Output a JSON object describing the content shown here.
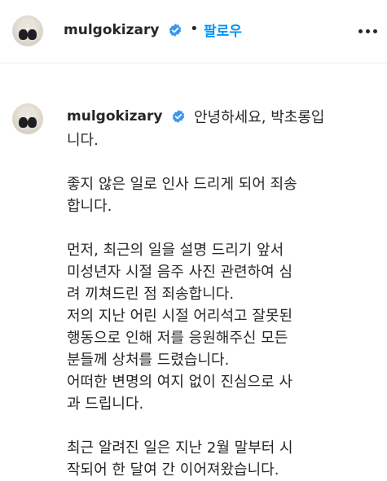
{
  "header": {
    "username": "mulgokizary",
    "separator": "•",
    "follow_label": "팔로우"
  },
  "post": {
    "username": "mulgokizary",
    "caption_first_line": "안녕하세요, 박초롱입",
    "caption_lines": [
      "니다.",
      "",
      "좋지 않은 일로 인사 드리게 되어 죄송",
      "합니다.",
      "",
      "먼저, 최근의 일을 설명 드리기 앞서",
      "미성년자 시절 음주 사진 관련하여 심",
      "려 끼쳐드린 점 죄송합니다.",
      "저의 지난 어린 시절 어리석고 잘못된",
      "행동으로 인해 저를 응원해주신 모든",
      "분들께 상처를 드렸습니다.",
      "어떠한 변명의 여지 없이 진심으로 사",
      "과 드립니다.",
      "",
      "최근 알려진 일은 지난 2월 말부터 시",
      "작되어 한 달여 간 이어져왔습니다."
    ]
  },
  "colors": {
    "accent": "#0095f6",
    "text": "#262626",
    "divider": "#efefef"
  },
  "icons": {
    "verified": "verified-badge-icon",
    "more": "more-options-icon"
  }
}
